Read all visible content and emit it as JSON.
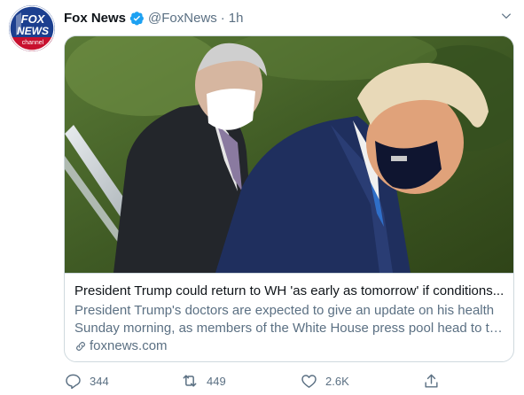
{
  "tweet": {
    "author_name": "Fox News",
    "handle": "@FoxNews",
    "separator": "·",
    "time": "1h",
    "avatar": {
      "logo_line1": "FOX",
      "logo_line2": "NEWS",
      "logo_line3": "channel",
      "brand_color": "#1c3f8f",
      "accent_color": "#c8102e"
    },
    "verified_color": "#1da1f2",
    "more_icon": "chevron-down-icon"
  },
  "card": {
    "image_description_icon": "photo",
    "title": "President Trump could return to WH 'as early as tomorrow' if conditions...",
    "description_line1": "President Trump's doctors are expected to give an update on his health",
    "description_line2": "Sunday morning, as members of the White House press pool head to th...",
    "domain": "foxnews.com"
  },
  "actions": {
    "reply_count": "344",
    "retweet_count": "449",
    "like_count": "2.6K",
    "icons": [
      "reply-icon",
      "retweet-icon",
      "like-icon",
      "share-icon"
    ]
  }
}
